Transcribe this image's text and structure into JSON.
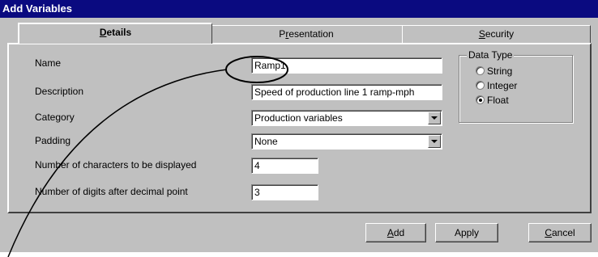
{
  "window": {
    "title": "Add Variables"
  },
  "tabs": [
    {
      "pre": "",
      "key": "D",
      "post": "etails",
      "active": true
    },
    {
      "pre": "P",
      "key": "r",
      "post": "esentation",
      "active": false
    },
    {
      "pre": "",
      "key": "S",
      "post": "ecurity",
      "active": false
    }
  ],
  "fields": {
    "name": {
      "label": "Name",
      "value": "Ramp1"
    },
    "description": {
      "label": "Description",
      "value": "Speed of production line 1 ramp-mph"
    },
    "category": {
      "label": "Category",
      "value": "Production variables"
    },
    "padding": {
      "label": "Padding",
      "value": "None"
    },
    "num_chars": {
      "label": "Number of characters to be displayed",
      "value": "4"
    },
    "num_digits": {
      "label": "Number of digits after decimal point",
      "value": "3"
    }
  },
  "data_type": {
    "legend": "Data Type",
    "options": [
      "String",
      "Integer",
      "Float"
    ],
    "selected": "Float"
  },
  "buttons": {
    "add": {
      "pre": "",
      "key": "A",
      "post": "dd"
    },
    "apply": {
      "label": "Apply"
    },
    "cancel": {
      "pre": "",
      "key": "C",
      "post": "ancel"
    }
  },
  "colors": {
    "titlebar": "#0a0a80",
    "face": "#c0c0c0"
  },
  "annotation": {
    "shape": "ellipse-with-line",
    "target": "name-field"
  }
}
